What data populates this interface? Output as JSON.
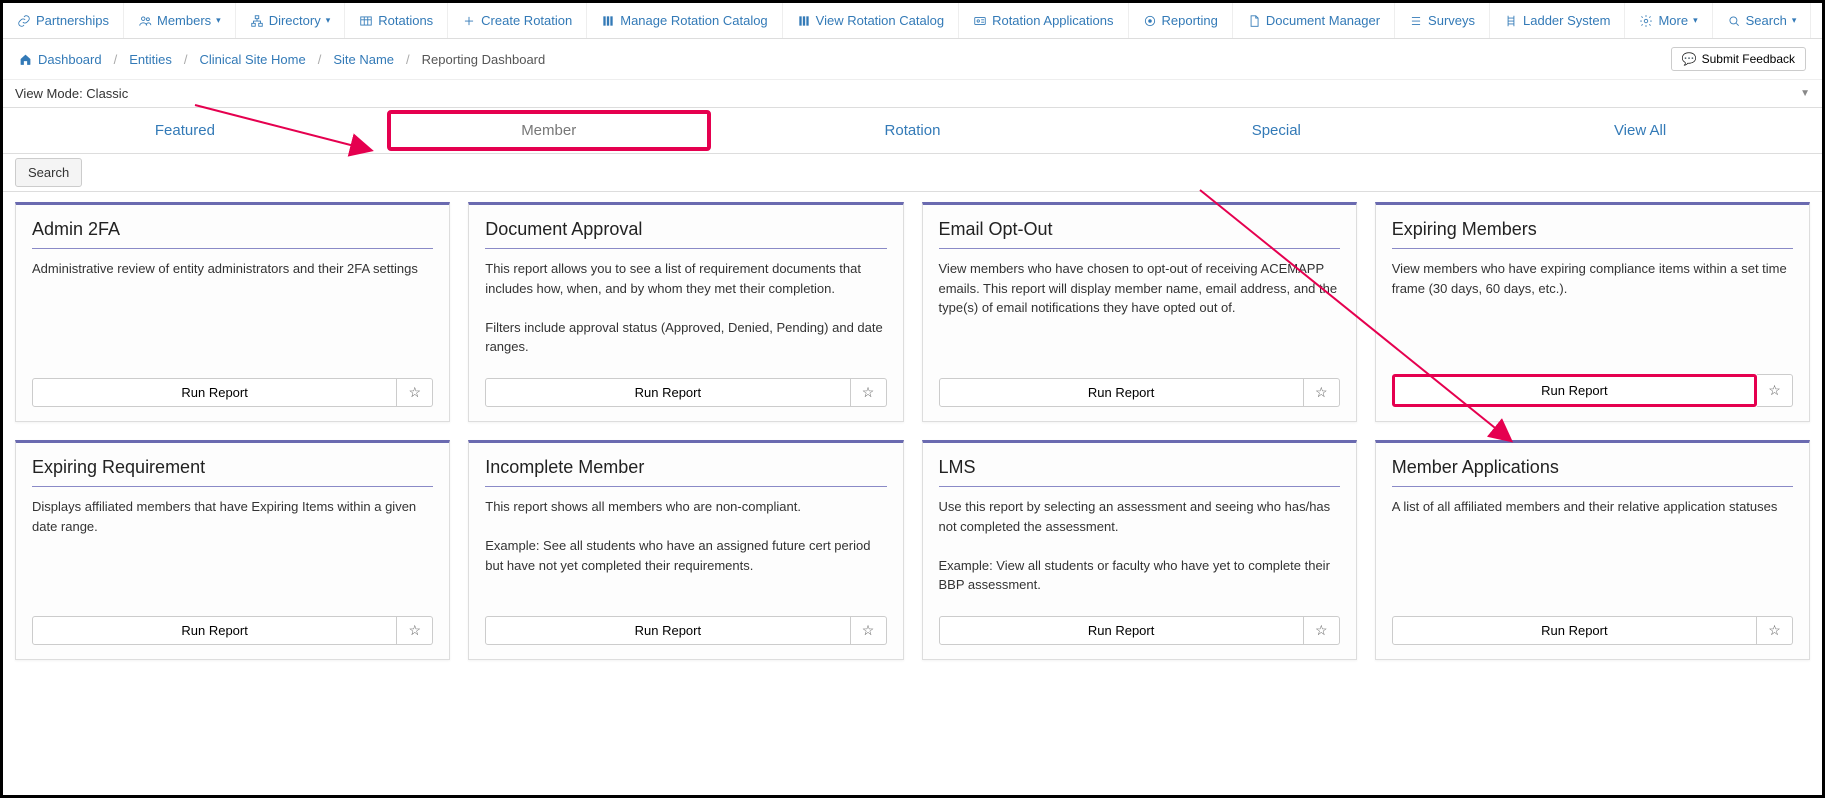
{
  "nav": [
    {
      "icon": "link",
      "label": "Partnerships",
      "caret": false
    },
    {
      "icon": "users",
      "label": "Members",
      "caret": true
    },
    {
      "icon": "sitemap",
      "label": "Directory",
      "caret": true
    },
    {
      "icon": "table",
      "label": "Rotations",
      "caret": false
    },
    {
      "icon": "plus",
      "label": "Create Rotation",
      "caret": false
    },
    {
      "icon": "books",
      "label": "Manage Rotation Catalog",
      "caret": false
    },
    {
      "icon": "books",
      "label": "View Rotation Catalog",
      "caret": false
    },
    {
      "icon": "idcard",
      "label": "Rotation Applications",
      "caret": false
    },
    {
      "icon": "target",
      "label": "Reporting",
      "caret": false
    },
    {
      "icon": "doc",
      "label": "Document Manager",
      "caret": false
    },
    {
      "icon": "list",
      "label": "Surveys",
      "caret": false
    },
    {
      "icon": "ladder",
      "label": "Ladder System",
      "caret": false
    },
    {
      "icon": "gear",
      "label": "More",
      "caret": true
    },
    {
      "icon": "search",
      "label": "Search",
      "caret": true
    }
  ],
  "breadcrumb": {
    "items": [
      "Dashboard",
      "Entities",
      "Clinical Site Home",
      "Site Name"
    ],
    "current": "Reporting Dashboard"
  },
  "feedback_label": "Submit Feedback",
  "viewmode_label": "View Mode: Classic",
  "tabs": [
    "Featured",
    "Member",
    "Rotation",
    "Special",
    "View All"
  ],
  "active_tab_index": 1,
  "search_label": "Search",
  "run_label": "Run Report",
  "cards": [
    {
      "title": "Admin 2FA",
      "desc": "Administrative review of entity administrators and their 2FA settings"
    },
    {
      "title": "Document Approval",
      "desc": "This report allows you to see a list of requirement documents that includes how, when, and by whom they met their completion.\n\nFilters include approval status (Approved, Denied, Pending) and date ranges."
    },
    {
      "title": "Email Opt-Out",
      "desc": "View members who have chosen to opt-out of receiving ACEMAPP emails. This report will display member name, email address, and the type(s) of email notifications they have opted out of."
    },
    {
      "title": "Expiring Members",
      "desc": "View members who have expiring compliance items within a set time frame (30 days, 60 days, etc.)."
    },
    {
      "title": "Expiring Requirement",
      "desc": "Displays affiliated members that have Expiring Items within a given date range."
    },
    {
      "title": "Incomplete Member",
      "desc": "This report shows all members who are non-compliant.\n\nExample: See all students who have an assigned future cert period but have not yet completed their requirements."
    },
    {
      "title": "LMS",
      "desc": "Use this report by selecting an assessment and seeing who has/has not completed the assessment.\n\nExample: View all students or faculty who have yet to complete their BBP assessment."
    },
    {
      "title": "Member Applications",
      "desc": "A list of all affiliated members and their relative application statuses"
    }
  ],
  "highlight_run_index": 3,
  "colors": {
    "accent": "#337ab7",
    "highlight": "#e5004f",
    "cardtop": "#6a6ab0"
  }
}
